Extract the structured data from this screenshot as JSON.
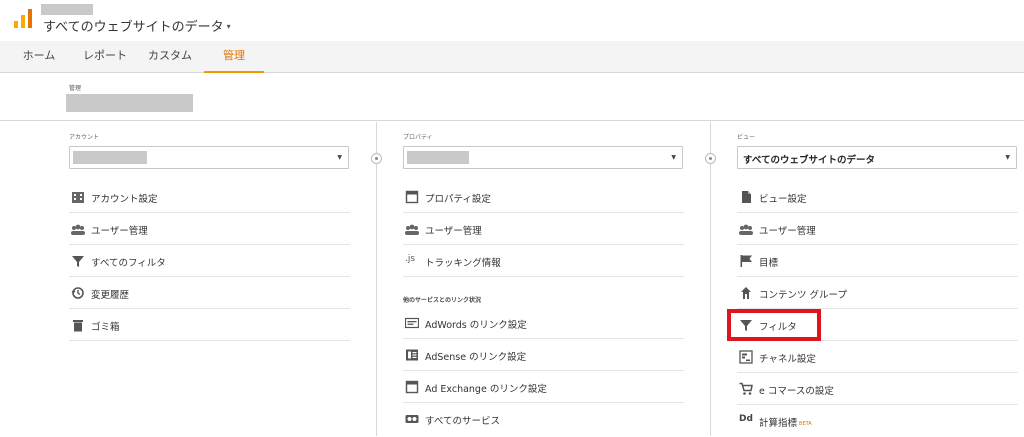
{
  "header": {
    "view_title": "すべてのウェブサイトのデータ",
    "caret": "▾",
    "brand_colors": [
      "#f29900",
      "#e37400"
    ]
  },
  "tabs": [
    {
      "label": "ホーム",
      "active": false
    },
    {
      "label": "レポート",
      "active": false
    },
    {
      "label": "カスタム",
      "active": false
    },
    {
      "label": "管理",
      "active": true
    }
  ],
  "admin": {
    "heading": "管理"
  },
  "account": {
    "title": "アカウント",
    "items": [
      {
        "label": "アカウント設定",
        "icon": "building-icon"
      },
      {
        "label": "ユーザー管理",
        "icon": "users-icon"
      },
      {
        "label": "すべてのフィルタ",
        "icon": "filter-icon"
      },
      {
        "label": "変更履歴",
        "icon": "history-icon"
      },
      {
        "label": "ゴミ箱",
        "icon": "trash-icon"
      }
    ]
  },
  "property": {
    "title": "プロパティ",
    "items": [
      {
        "label": "プロパティ設定",
        "icon": "property-icon"
      },
      {
        "label": "ユーザー管理",
        "icon": "users-icon"
      },
      {
        "label": "トラッキング情報",
        "icon": "js-icon",
        "icon_text": ".js"
      }
    ],
    "section_label": "他のサービスとのリンク状況",
    "links": [
      {
        "label": "AdWords のリンク設定",
        "icon": "adwords-icon"
      },
      {
        "label": "AdSense のリンク設定",
        "icon": "adsense-icon"
      },
      {
        "label": "Ad Exchange のリンク設定",
        "icon": "adexchange-icon"
      },
      {
        "label": "すべてのサービス",
        "icon": "link-icon"
      }
    ]
  },
  "view": {
    "title": "ビュー",
    "dropdown_value": "すべてのウェブサイトのデータ",
    "items": [
      {
        "label": "ビュー設定",
        "icon": "document-icon"
      },
      {
        "label": "ユーザー管理",
        "icon": "users-icon"
      },
      {
        "label": "目標",
        "icon": "flag-icon"
      },
      {
        "label": "コンテンツ グループ",
        "icon": "content-group-icon"
      },
      {
        "label": "フィルタ",
        "icon": "filter-icon"
      },
      {
        "label": "チャネル設定",
        "icon": "channel-icon"
      },
      {
        "label": "e コマースの設定",
        "icon": "cart-icon"
      },
      {
        "label": "計算指標",
        "icon": "dd-icon",
        "icon_text": "Dd",
        "badge": "BETA"
      }
    ]
  },
  "highlight_color": "#e0141d"
}
